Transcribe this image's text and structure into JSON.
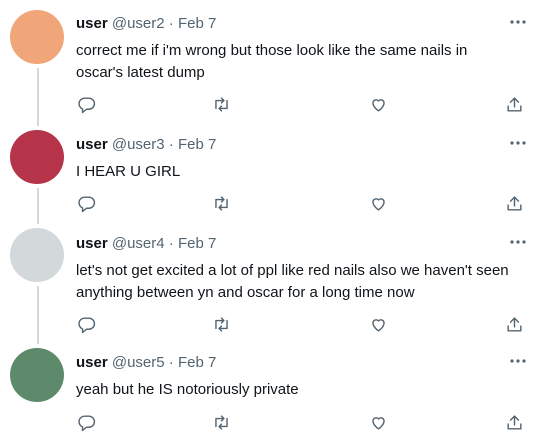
{
  "tweets": [
    {
      "name": "user",
      "handle": "@user2",
      "sep": "·",
      "date": "Feb 7",
      "text": "correct me if i'm wrong but those look like the same nails in oscar's latest dump",
      "avatar_color": "#f0a679"
    },
    {
      "name": "user",
      "handle": "@user3",
      "sep": "·",
      "date": "Feb 7",
      "text": "I HEAR U GIRL",
      "avatar_color": "#b5344a"
    },
    {
      "name": "user",
      "handle": "@user4",
      "sep": "·",
      "date": "Feb 7",
      "text": "let's not get excited a lot of ppl like red nails also we haven't seen anything between yn and oscar for a long time now",
      "avatar_color": "#d3d8db"
    },
    {
      "name": "user",
      "handle": "@user5",
      "sep": "·",
      "date": "Feb 7",
      "text": "yeah but he IS notoriously private",
      "avatar_color": "#5e8a6c"
    }
  ],
  "icons": {
    "reply": "reply-icon",
    "retweet": "retweet-icon",
    "like": "heart-icon",
    "share": "share-icon",
    "more": "more-icon"
  },
  "colors": {
    "text": "#0f1419",
    "secondary": "#536471",
    "thread_line": "#cfd9de"
  }
}
